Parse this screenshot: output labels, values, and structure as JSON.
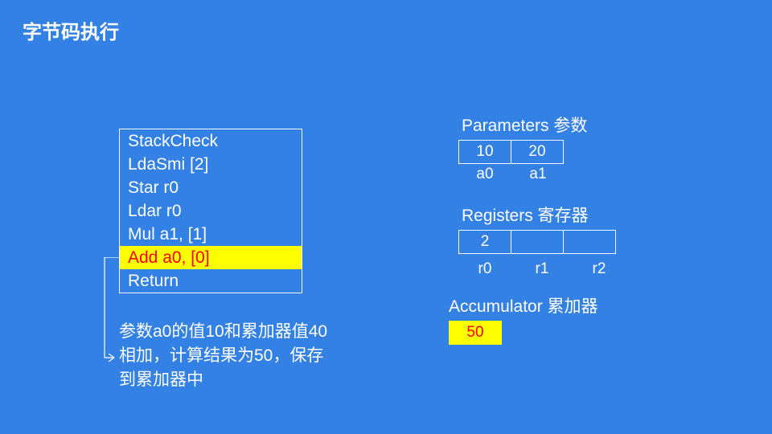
{
  "title": "字节码执行",
  "bytecode": {
    "lines": [
      "StackCheck",
      "LdaSmi [2]",
      "Star r0",
      "Ldar r0",
      "Mul a1, [1]",
      "Add a0, [0]",
      "Return"
    ],
    "highlight_index": 5
  },
  "annotation": "参数a0的值10和累加器值40相加，计算结果为50，保存到累加器中",
  "parameters": {
    "label": "Parameters 参数",
    "cells": [
      "10",
      "20"
    ],
    "names": [
      "a0",
      "a1"
    ]
  },
  "registers": {
    "label": "Registers 寄存器",
    "cells": [
      "2",
      "",
      ""
    ],
    "names": [
      "r0",
      "r1",
      "r2"
    ]
  },
  "accumulator": {
    "label": "Accumulator 累加器",
    "value": "50",
    "highlight": true
  }
}
